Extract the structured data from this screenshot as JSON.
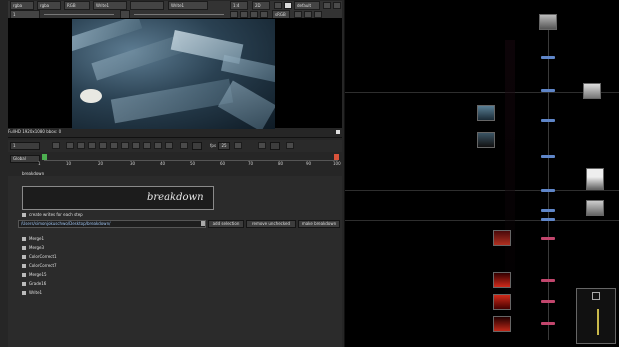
{
  "toolbar": {
    "row1": [
      "rgba",
      "rgba",
      "RGB",
      "Write1",
      "",
      "Write1",
      "1:4",
      "2D",
      "",
      "default"
    ],
    "frame": "1",
    "format": "sRGB"
  },
  "viewer": {
    "status": "FullHD 1920x1080 bbox: 0"
  },
  "timeline": {
    "frame_field": "1",
    "fps_label": "fps",
    "fps_value": "25",
    "end_field": "99",
    "range_label": "Global",
    "ticks": [
      "1",
      "10",
      "20",
      "30",
      "40",
      "50",
      "60",
      "70",
      "80",
      "90",
      "100"
    ]
  },
  "panel": {
    "tab": "breakdown",
    "header_title": "breakdown",
    "create_writes_label": "create writes for each step",
    "path": "/Users/simonjokuschwo/Desktop/breakdown/",
    "buttons": {
      "add_selection": "add selection",
      "remove_unchecked": "remove unchecked",
      "make_breakdown": "make breakdown"
    },
    "nodes": [
      "Merge1",
      "Merge3",
      "ColorCorrect1",
      "ColorCorrect7",
      "Merge15",
      "Grade16",
      "Write1"
    ]
  },
  "colors": {
    "node_blue": "#5f86c9",
    "node_pink": "#c2466d",
    "node_yellow": "#c8b84a"
  }
}
